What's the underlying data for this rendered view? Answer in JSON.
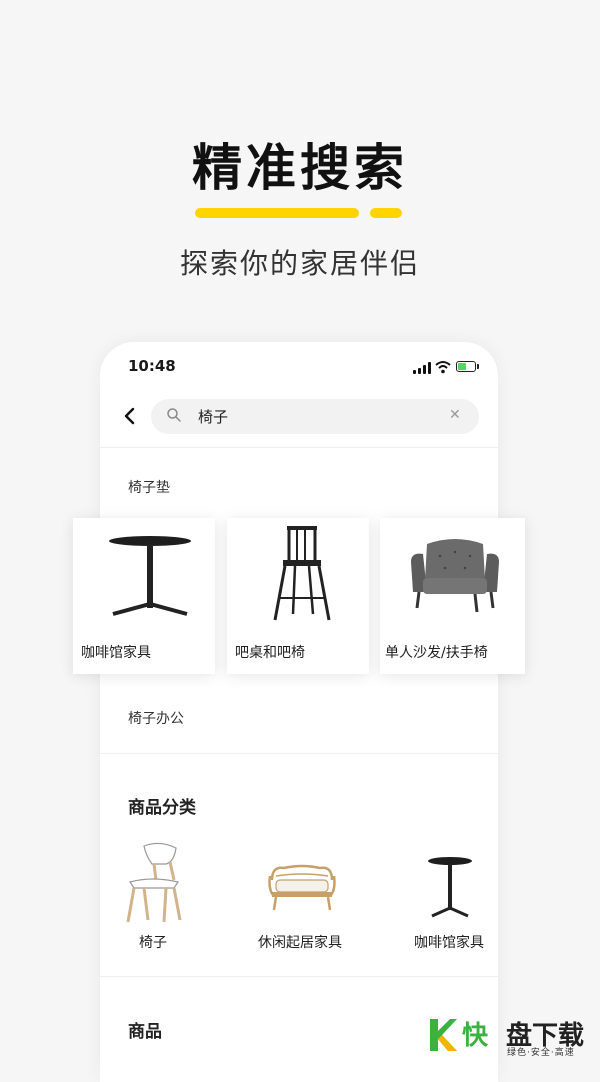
{
  "hero": {
    "title": "精准搜索",
    "subtitle": "探索你的家居伴侣",
    "accent_color": "#ffd400"
  },
  "status_bar": {
    "time": "10:48",
    "icons": [
      "signal-icon",
      "wifi-icon",
      "battery-icon"
    ]
  },
  "search": {
    "back_icon": "chevron-left-icon",
    "search_icon": "search-icon",
    "query": "椅子",
    "clear_icon": "close-icon"
  },
  "suggestions": [
    "椅子垫",
    "椅子办公"
  ],
  "result_cards": [
    {
      "label": "咖啡馆家具",
      "icon": "cafe-table-image"
    },
    {
      "label": "吧桌和吧椅",
      "icon": "bar-stool-image"
    },
    {
      "label": "单人沙发/扶手椅",
      "icon": "armchair-image"
    }
  ],
  "category_section": {
    "title": "商品分类",
    "items": [
      {
        "label": "椅子",
        "icon": "chair-image"
      },
      {
        "label": "休闲起居家具",
        "icon": "rattan-sofa-image"
      },
      {
        "label": "咖啡馆家具",
        "icon": "cafe-table-image"
      }
    ]
  },
  "products_section": {
    "title": "商品"
  },
  "watermark": {
    "big_text_1": "快",
    "big_text_2": "盘下载",
    "small_text": "绿色·安全·高速",
    "color": "#3bb13e"
  }
}
